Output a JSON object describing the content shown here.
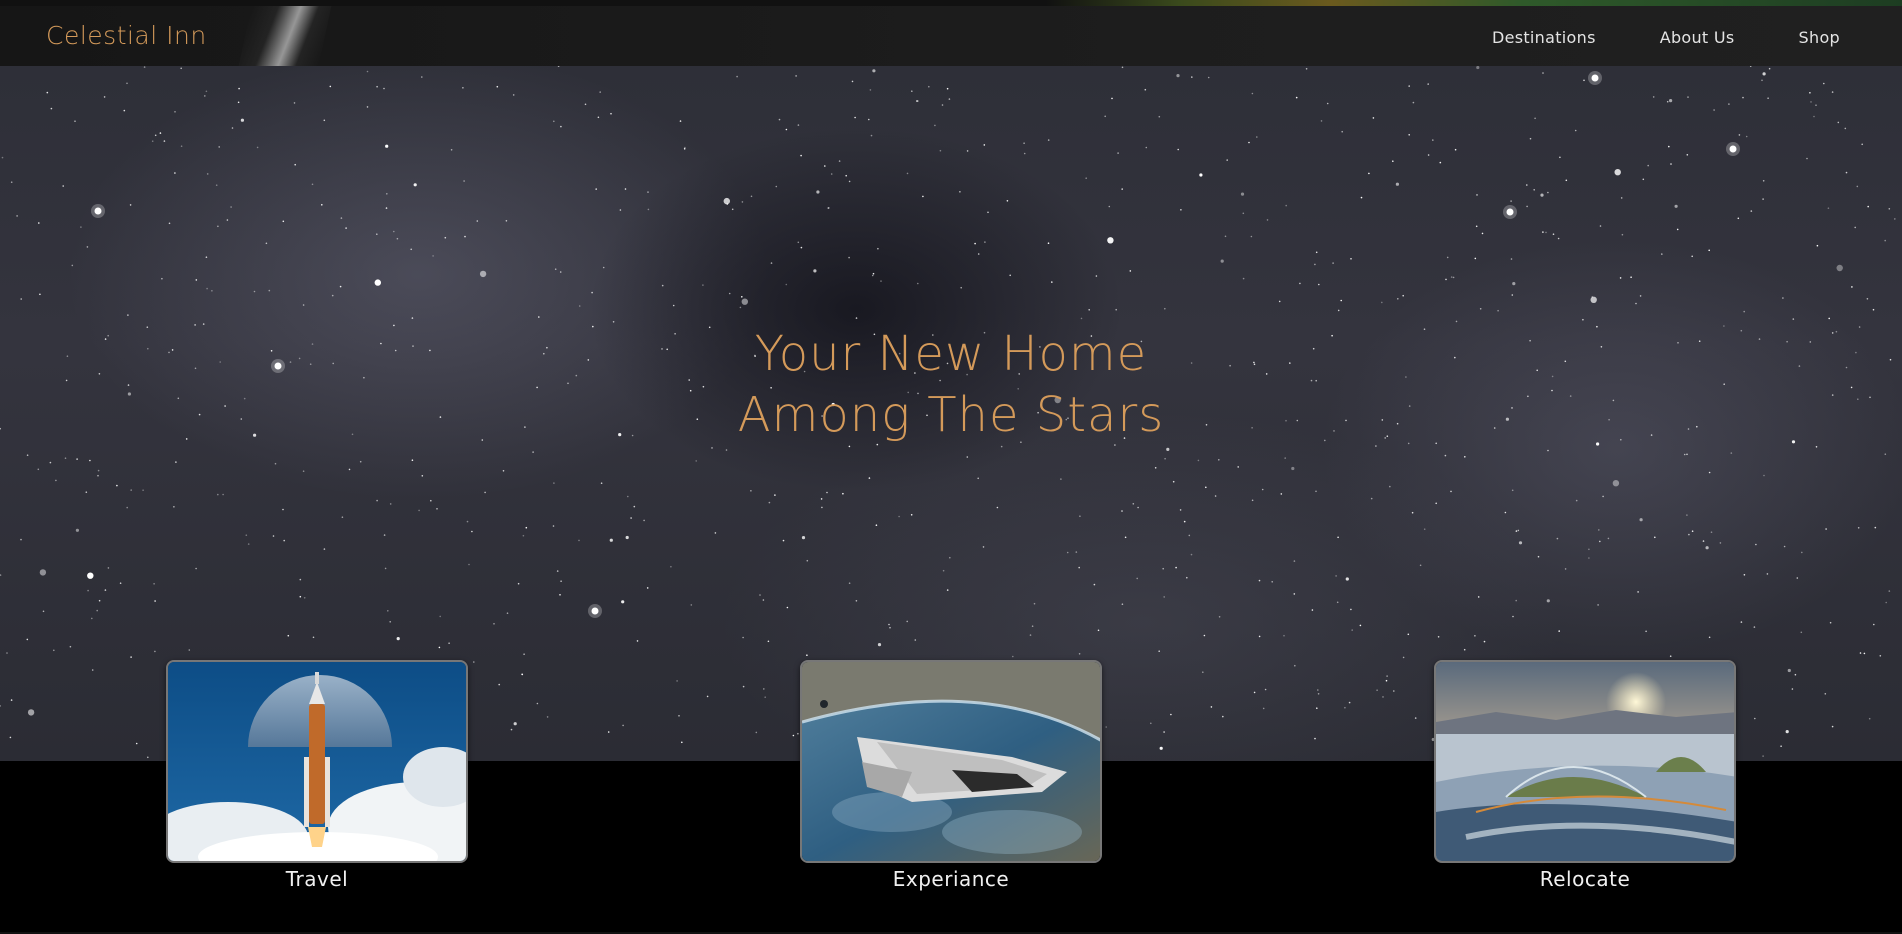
{
  "header": {
    "brand": "Celestial Inn",
    "nav": [
      {
        "label": "Destinations"
      },
      {
        "label": "About Us"
      },
      {
        "label": "Shop"
      }
    ]
  },
  "hero": {
    "headline_line1": "Your New Home",
    "headline_line2": "Among The Stars"
  },
  "cards": [
    {
      "label": "Travel",
      "image": "rocket-launch-icon"
    },
    {
      "label": "Experiance",
      "image": "spaceship-over-earth-icon"
    },
    {
      "label": "Relocate",
      "image": "dome-colony-icon"
    }
  ],
  "colors": {
    "accent": "#d49a5a",
    "header_bg": "#1b1b1b",
    "page_bg": "#000000"
  }
}
